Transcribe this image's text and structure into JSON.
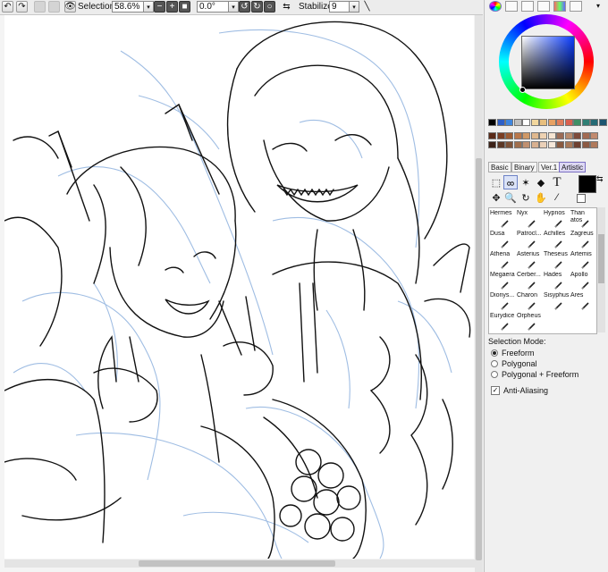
{
  "toolbar": {
    "selection_label": "Selection",
    "zoom_value": "58.6%",
    "angle_value": "0.0°",
    "stabilizer_label": "Stabilizer",
    "stabilizer_value": "9"
  },
  "colors": {
    "current_color": "#000000",
    "palette_row1": [
      "#000000",
      "#2d5fc8",
      "#3f86df",
      "#c0c0c0",
      "#ffffff",
      "#f2d79e",
      "#e8bf7e",
      "#e7a163",
      "#e07c59",
      "#d9604f",
      "#3f8f66",
      "#2f7f74",
      "#256b75",
      "#1c5570"
    ],
    "palette_row2": [
      "#5a2a18",
      "#7a3d22",
      "#9c5a32",
      "#b9774b",
      "#cf9866",
      "#e0b88e",
      "#eed2b2",
      "#f6e5d2",
      "#9b6b55",
      "#b88a6c",
      "#7d4a3a",
      "#a26a52",
      "#c28b6f"
    ],
    "palette_row3": [
      "#3c2218",
      "#5c3826",
      "#7e5238",
      "#a06e4c",
      "#c09070",
      "#d8b090",
      "#ead0b8",
      "#f6e8da",
      "#8a5a40",
      "#a87858",
      "#6e4030",
      "#8c5a44",
      "#b07a5c"
    ]
  },
  "color_tabs": [
    "Basic",
    "Binary",
    "Ver.1",
    "Artistic"
  ],
  "brushes": [
    "Hermes",
    "Nyx",
    "Hypnos",
    "Thanatos",
    "Dusa",
    "Patroclus",
    "Achilles",
    "Zagreus",
    "Athena",
    "Asterius",
    "Theseus",
    "Artemis",
    "Megaera",
    "Cerberus",
    "Hades",
    "Apollo",
    "Dionysus",
    "Charon",
    "Sisyphus",
    "Ares",
    "Eurydice",
    "Orpheus"
  ],
  "brush_labels": [
    "Hermes",
    "Nyx",
    "Hypnos",
    "Than\natos",
    "Dusa",
    "Patrocl...",
    "Achilles",
    "Zagreus",
    "Athena",
    "Asterius",
    "Theseus",
    "Artemis",
    "Megaera",
    "Cerber...",
    "Hades",
    "Apollo",
    "Dionys...",
    "Charon",
    "Sisyphus",
    "Ares",
    "Eurydice",
    "Orpheus"
  ],
  "selection_mode": {
    "title": "Selection Mode:",
    "options": [
      "Freeform",
      "Polygonal",
      "Polygonal + Freeform"
    ],
    "selected": "Freeform"
  },
  "anti_aliasing": {
    "label": "Anti-Aliasing",
    "checked": true
  }
}
